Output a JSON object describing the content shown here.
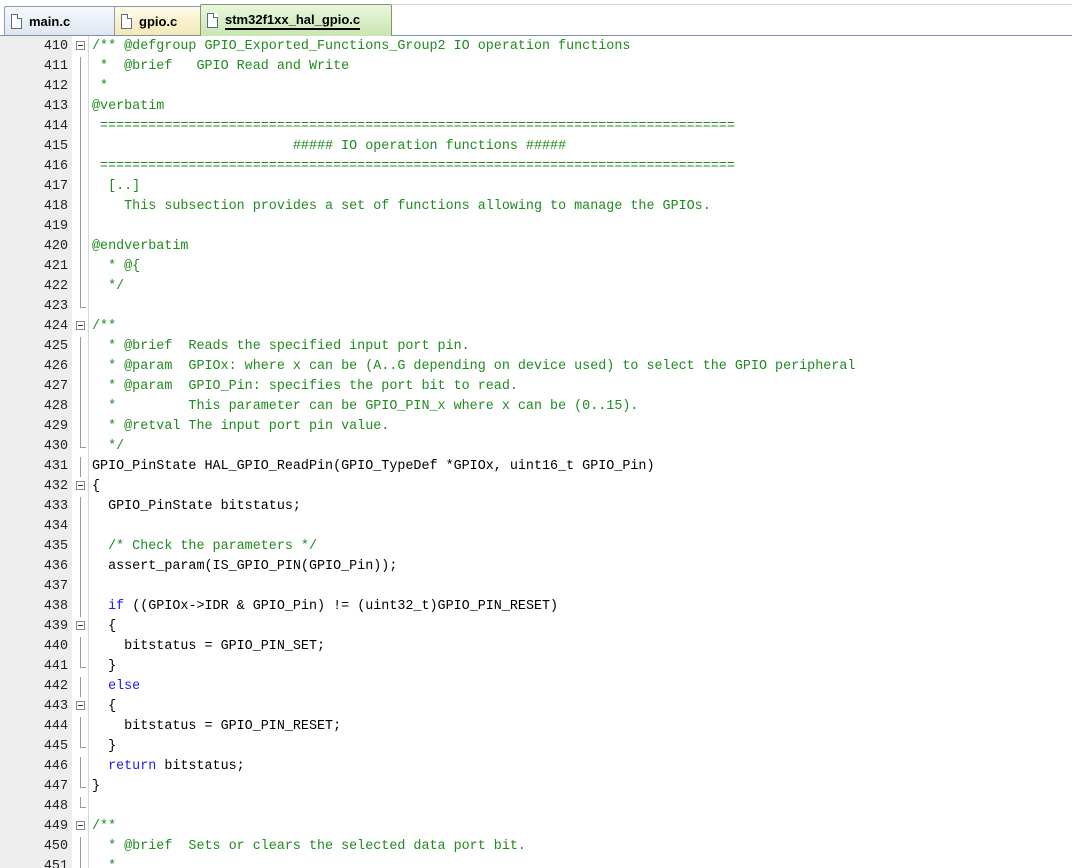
{
  "tabs": [
    {
      "label": "main.c",
      "active": false,
      "style": "blue"
    },
    {
      "label": "gpio.c",
      "active": false,
      "style": "yellow"
    },
    {
      "label": "stm32f1xx_hal_gpio.c",
      "active": true,
      "style": "green"
    }
  ],
  "colors": {
    "comment": "#1f8b1f",
    "keyword": "#1e1eee",
    "text": "#000000",
    "gutter": "#eeeeee"
  },
  "lines": [
    {
      "num": "410",
      "fold": "open",
      "kind": "comment",
      "text": "/** @defgroup GPIO_Exported_Functions_Group2 IO operation functions"
    },
    {
      "num": "411",
      "fold": "line",
      "kind": "comment",
      "text": " *  @brief   GPIO Read and Write"
    },
    {
      "num": "412",
      "fold": "line",
      "kind": "comment",
      "text": " *"
    },
    {
      "num": "413",
      "fold": "line",
      "kind": "comment",
      "text": "@verbatim"
    },
    {
      "num": "414",
      "fold": "line",
      "kind": "comment",
      "text": " ==============================================================================="
    },
    {
      "num": "415",
      "fold": "line",
      "kind": "comment",
      "text": "                         ##### IO operation functions #####"
    },
    {
      "num": "416",
      "fold": "line",
      "kind": "comment",
      "text": " ==============================================================================="
    },
    {
      "num": "417",
      "fold": "line",
      "kind": "comment",
      "text": "  [..]"
    },
    {
      "num": "418",
      "fold": "line",
      "kind": "comment",
      "text": "    This subsection provides a set of functions allowing to manage the GPIOs."
    },
    {
      "num": "419",
      "fold": "line",
      "kind": "comment",
      "text": ""
    },
    {
      "num": "420",
      "fold": "line",
      "kind": "comment",
      "text": "@endverbatim"
    },
    {
      "num": "421",
      "fold": "line",
      "kind": "comment",
      "text": "  * @{"
    },
    {
      "num": "422",
      "fold": "line",
      "kind": "comment",
      "text": "  */"
    },
    {
      "num": "423",
      "fold": "end",
      "kind": "plain",
      "text": ""
    },
    {
      "num": "424",
      "fold": "open",
      "kind": "comment",
      "text": "/**"
    },
    {
      "num": "425",
      "fold": "line",
      "kind": "comment",
      "text": "  * @brief  Reads the specified input port pin."
    },
    {
      "num": "426",
      "fold": "line",
      "kind": "comment",
      "text": "  * @param  GPIOx: where x can be (A..G depending on device used) to select the GPIO peripheral"
    },
    {
      "num": "427",
      "fold": "line",
      "kind": "comment",
      "text": "  * @param  GPIO_Pin: specifies the port bit to read."
    },
    {
      "num": "428",
      "fold": "line",
      "kind": "comment",
      "text": "  *         This parameter can be GPIO_PIN_x where x can be (0..15)."
    },
    {
      "num": "429",
      "fold": "line",
      "kind": "comment",
      "text": "  * @retval The input port pin value."
    },
    {
      "num": "430",
      "fold": "end",
      "kind": "comment",
      "text": "  */"
    },
    {
      "num": "431",
      "fold": "line",
      "kind": "plain",
      "text": "GPIO_PinState HAL_GPIO_ReadPin(GPIO_TypeDef *GPIOx, uint16_t GPIO_Pin)"
    },
    {
      "num": "432",
      "fold": "open",
      "kind": "plain",
      "text": "{"
    },
    {
      "num": "433",
      "fold": "line",
      "kind": "plain",
      "text": "  GPIO_PinState bitstatus;"
    },
    {
      "num": "434",
      "fold": "line",
      "kind": "plain",
      "text": ""
    },
    {
      "num": "435",
      "fold": "line",
      "kind": "comment",
      "text": "  /* Check the parameters */"
    },
    {
      "num": "436",
      "fold": "line",
      "kind": "plain",
      "text": "  assert_param(IS_GPIO_PIN(GPIO_Pin));"
    },
    {
      "num": "437",
      "fold": "line",
      "kind": "plain",
      "text": ""
    },
    {
      "num": "438",
      "fold": "line",
      "kind": "mixed",
      "segments": [
        {
          "k": "kw",
          "t": "  if"
        },
        {
          "k": "plain",
          "t": " ((GPIOx->IDR & GPIO_Pin) != (uint32_t)GPIO_PIN_RESET)"
        }
      ]
    },
    {
      "num": "439",
      "fold": "open",
      "kind": "plain",
      "text": "  {"
    },
    {
      "num": "440",
      "fold": "line",
      "kind": "plain",
      "text": "    bitstatus = GPIO_PIN_SET;"
    },
    {
      "num": "441",
      "fold": "end",
      "kind": "plain",
      "text": "  }"
    },
    {
      "num": "442",
      "fold": "line",
      "kind": "kw",
      "text": "  else"
    },
    {
      "num": "443",
      "fold": "open",
      "kind": "plain",
      "text": "  {"
    },
    {
      "num": "444",
      "fold": "line",
      "kind": "plain",
      "text": "    bitstatus = GPIO_PIN_RESET;"
    },
    {
      "num": "445",
      "fold": "end",
      "kind": "plain",
      "text": "  }"
    },
    {
      "num": "446",
      "fold": "line",
      "kind": "mixed",
      "segments": [
        {
          "k": "kw",
          "t": "  return"
        },
        {
          "k": "plain",
          "t": " bitstatus;"
        }
      ]
    },
    {
      "num": "447",
      "fold": "end",
      "kind": "plain",
      "text": "}"
    },
    {
      "num": "448",
      "fold": "end",
      "kind": "plain",
      "text": ""
    },
    {
      "num": "449",
      "fold": "open",
      "kind": "comment",
      "text": "/**"
    },
    {
      "num": "450",
      "fold": "line",
      "kind": "comment",
      "text": "  * @brief  Sets or clears the selected data port bit."
    },
    {
      "num": "451",
      "fold": "line",
      "kind": "comment",
      "text": "  *"
    }
  ]
}
